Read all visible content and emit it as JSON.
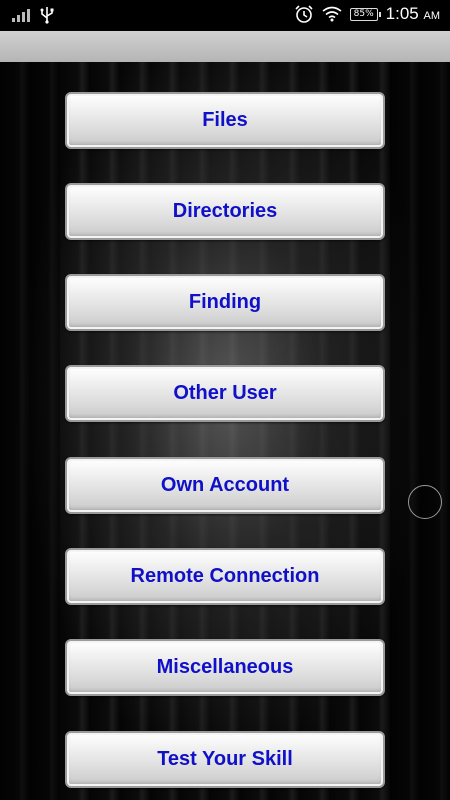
{
  "status_bar": {
    "battery": "85%",
    "time": "1:05",
    "ampm": "AM",
    "icons": [
      "signal-icon",
      "usb-icon",
      "alarm-icon",
      "wifi-icon",
      "battery-icon"
    ]
  },
  "menu": {
    "items": [
      {
        "label": "Files"
      },
      {
        "label": "Directories"
      },
      {
        "label": "Finding"
      },
      {
        "label": "Other User"
      },
      {
        "label": "Own Account"
      },
      {
        "label": "Remote Connection"
      },
      {
        "label": "Miscellaneous"
      },
      {
        "label": "Test Your Skill"
      }
    ]
  },
  "colors": {
    "button_text": "#1010c8",
    "action_bar": "#c4c4c4"
  }
}
